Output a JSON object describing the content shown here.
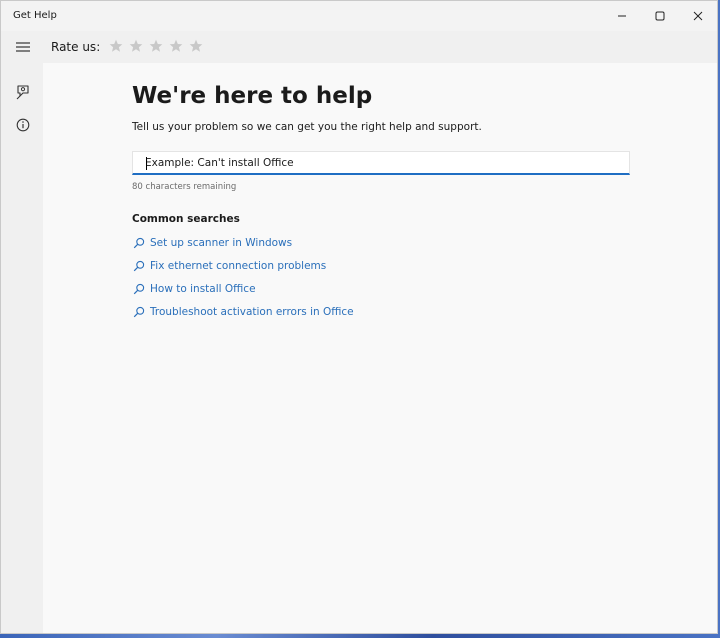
{
  "window": {
    "title": "Get Help"
  },
  "topbar": {
    "rate_label": "Rate us:",
    "stars": [
      {
        "icon": "star-icon"
      },
      {
        "icon": "star-icon"
      },
      {
        "icon": "star-icon"
      },
      {
        "icon": "star-icon"
      },
      {
        "icon": "star-icon"
      }
    ]
  },
  "sidebar": {
    "items": [
      {
        "icon": "hamburger-menu-icon"
      },
      {
        "icon": "contact-support-icon"
      },
      {
        "icon": "info-icon"
      }
    ]
  },
  "main": {
    "heading": "We're here to help",
    "subtitle": "Tell us your problem so we can get you the right help and support.",
    "search": {
      "placeholder": "Example: Can't install Office",
      "value": ""
    },
    "remaining": "80 characters remaining",
    "common_searches_title": "Common searches",
    "common_searches": [
      {
        "label": "Set up scanner in Windows"
      },
      {
        "label": "Fix ethernet connection problems"
      },
      {
        "label": "How to install Office"
      },
      {
        "label": "Troubleshoot activation errors in Office"
      }
    ]
  },
  "colors": {
    "link": "#2a6fba",
    "accent": "#1f6ec3",
    "star": "#c8c8c8"
  }
}
